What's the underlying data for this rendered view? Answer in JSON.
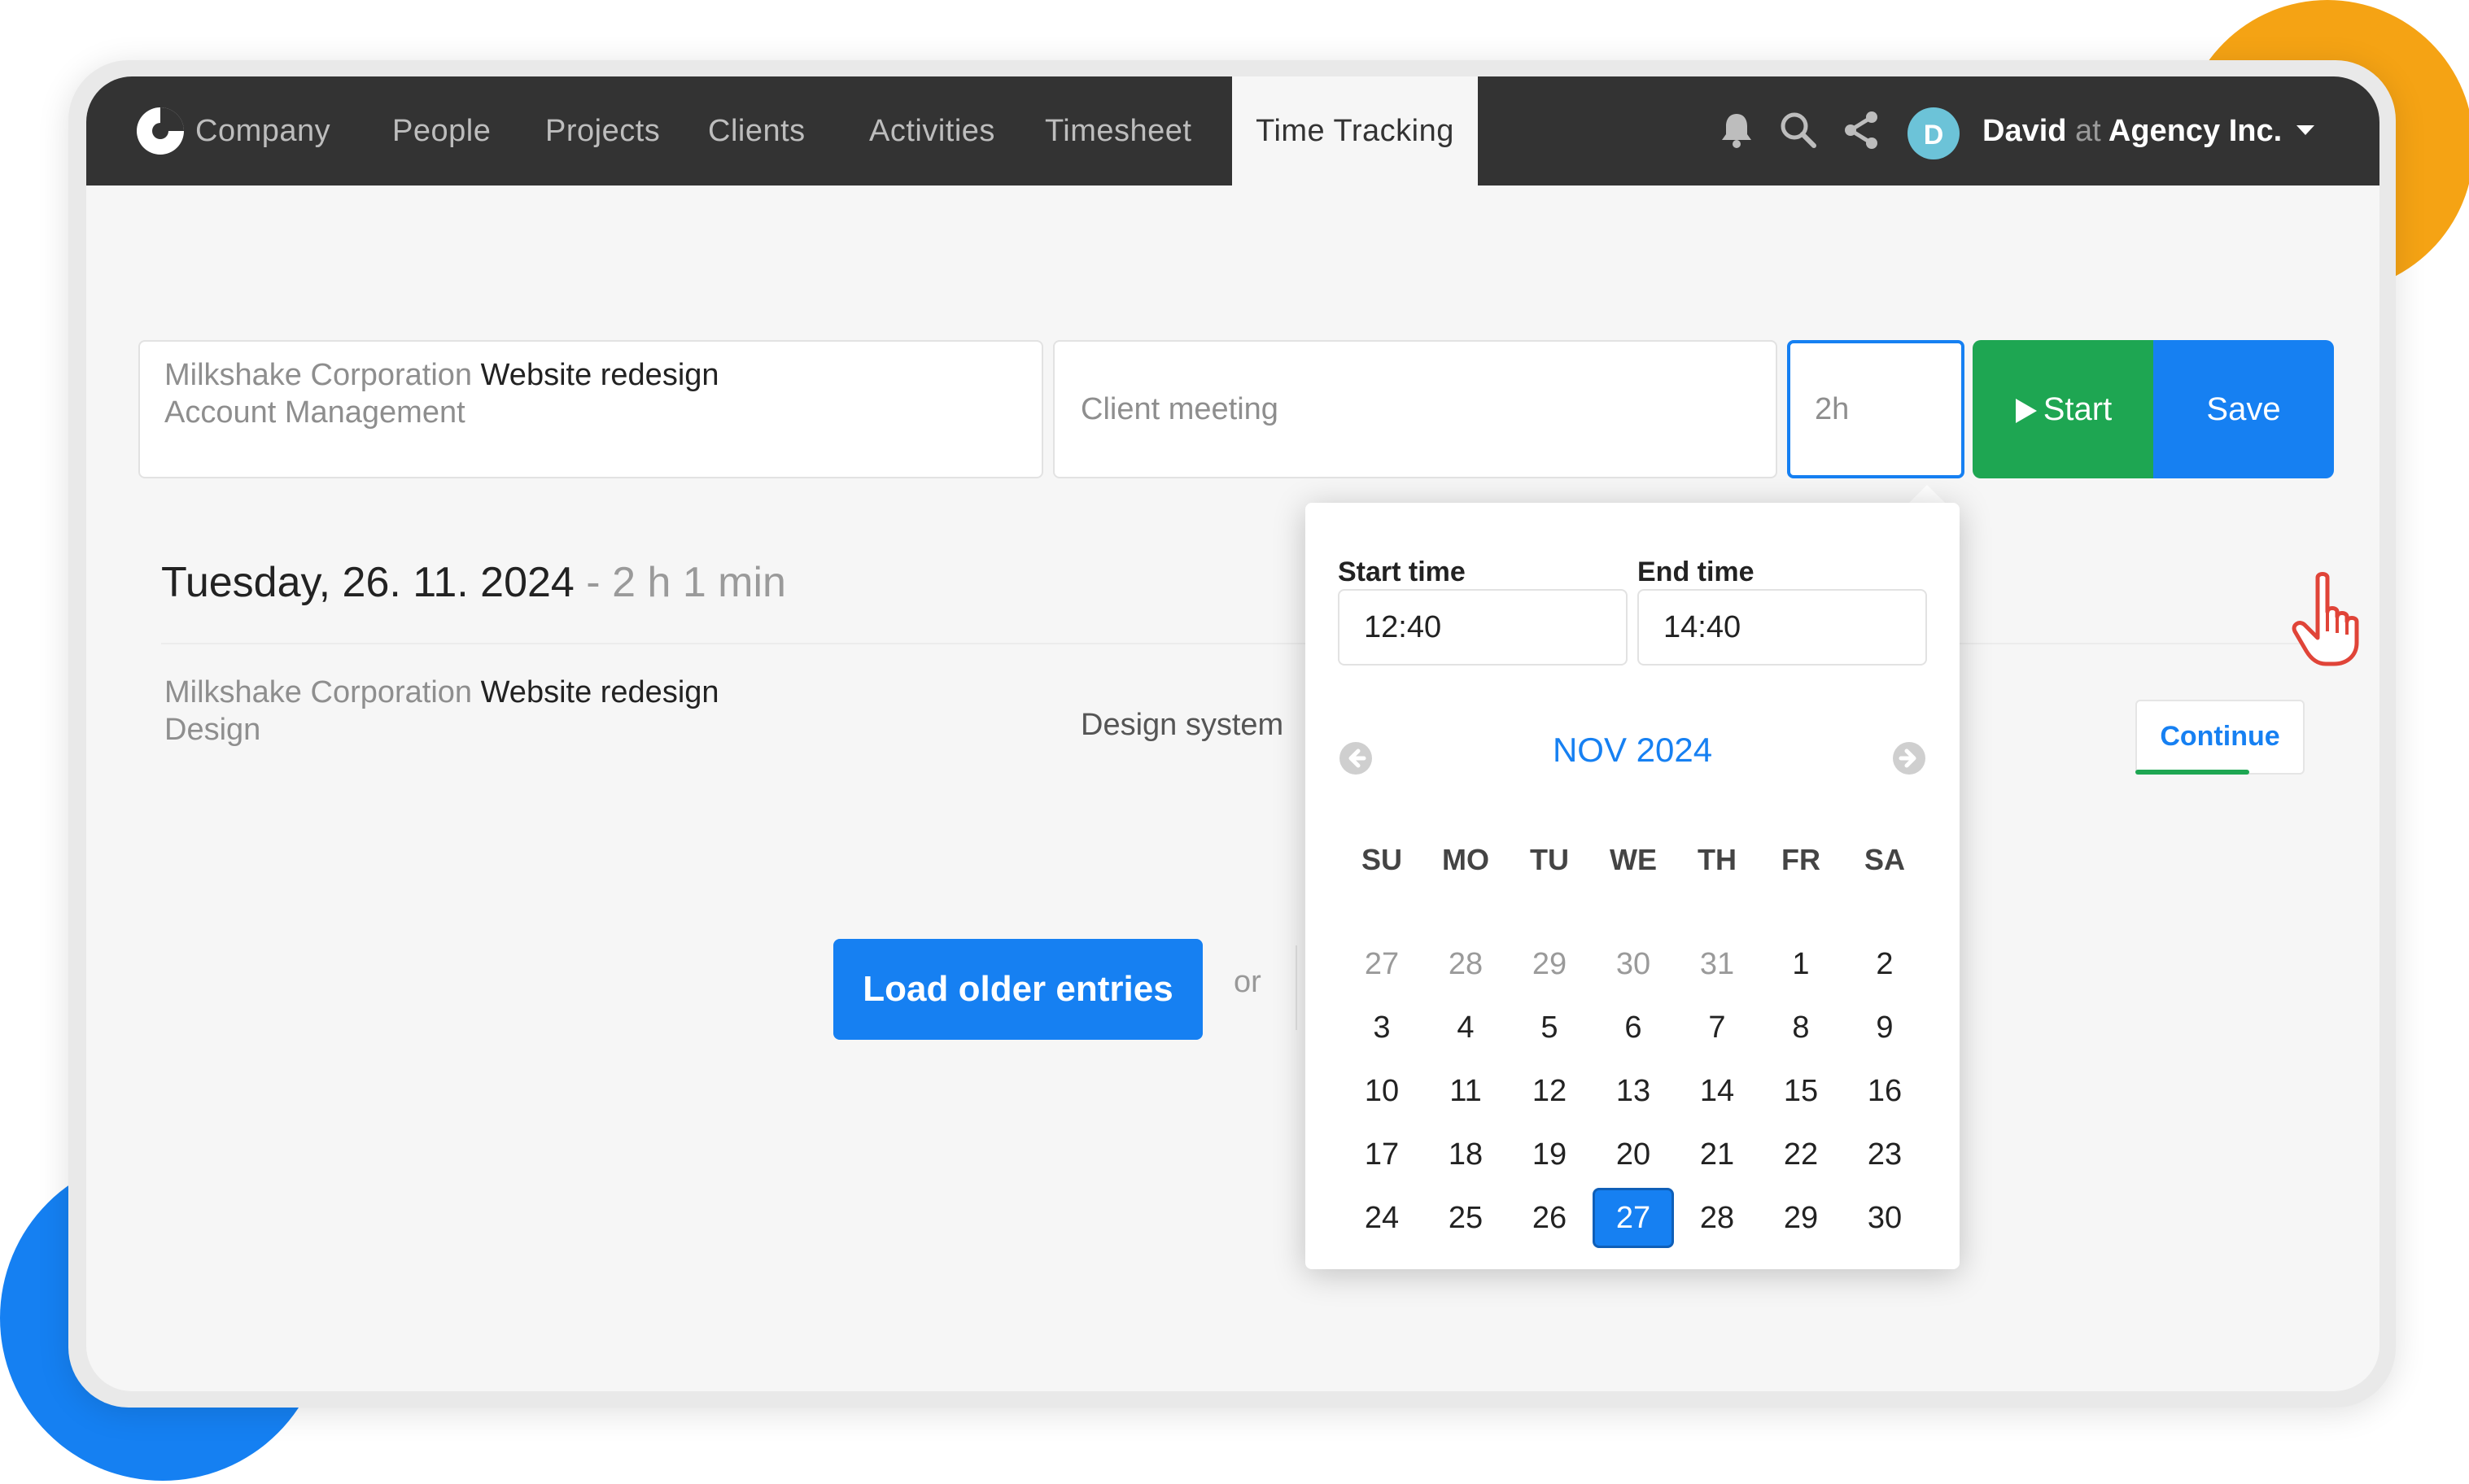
{
  "nav": {
    "items": [
      "Company",
      "People",
      "Projects",
      "Clients",
      "Activities",
      "Timesheet",
      "Time Tracking"
    ],
    "active": "Time Tracking"
  },
  "user": {
    "initial": "D",
    "name": "David",
    "at": "at",
    "company": "Agency Inc."
  },
  "entry_form": {
    "client": "Milkshake Corporation",
    "project": "Website redesign",
    "activity": "Account Management",
    "note": "Client meeting",
    "duration": "2h",
    "start_label": "Start",
    "save_label": "Save"
  },
  "day": {
    "date": "Tuesday, 26. 11. 2024",
    "separator": "-",
    "total": "2 h 1 min"
  },
  "entries": [
    {
      "client": "Milkshake Corporation",
      "project": "Website redesign",
      "activity": "Design",
      "note": "Design system",
      "continue_label": "Continue"
    }
  ],
  "load_more": {
    "button": "Load older entries",
    "or": "or"
  },
  "time_picker": {
    "start_label": "Start time",
    "end_label": "End time",
    "start_value": "12:40",
    "end_value": "14:40",
    "month_title": "NOV 2024",
    "weekdays": [
      "SU",
      "MO",
      "TU",
      "WE",
      "TH",
      "FR",
      "SA"
    ],
    "weeks": [
      [
        "27",
        "28",
        "29",
        "30",
        "31",
        "1",
        "2"
      ],
      [
        "3",
        "4",
        "5",
        "6",
        "7",
        "8",
        "9"
      ],
      [
        "10",
        "11",
        "12",
        "13",
        "14",
        "15",
        "16"
      ],
      [
        "17",
        "18",
        "19",
        "20",
        "21",
        "22",
        "23"
      ],
      [
        "24",
        "25",
        "26",
        "27",
        "28",
        "29",
        "30"
      ]
    ],
    "outside_month_first_row": 5,
    "selected_day": "27"
  },
  "colors": {
    "topbar": "#333333",
    "accent_blue": "#1680f2",
    "start_green": "#1ea652",
    "orange_blob": "#f5a314"
  }
}
